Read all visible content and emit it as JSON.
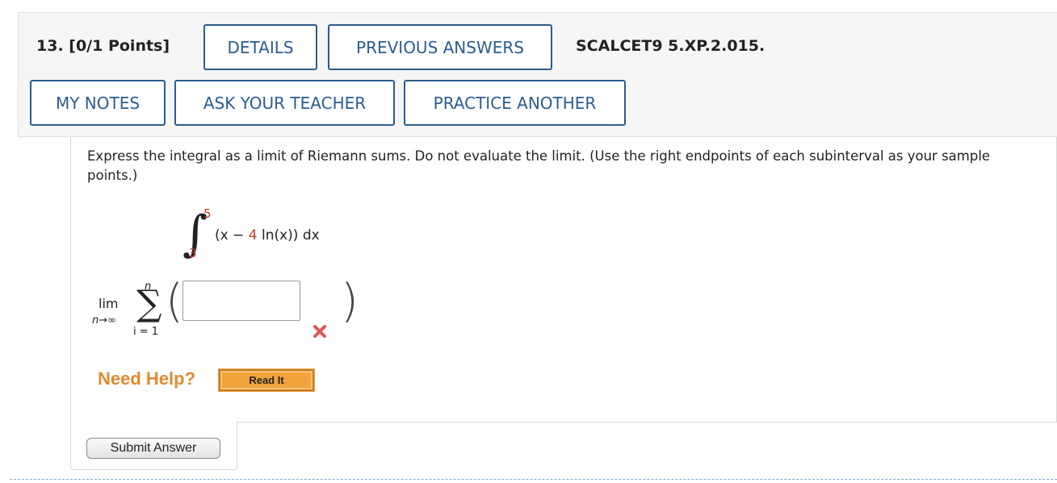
{
  "header": {
    "question_label": "13.  [0/1 Points]",
    "details_label": "DETAILS",
    "previous_answers_label": "PREVIOUS ANSWERS",
    "question_code": "SCALCET9 5.XP.2.015.",
    "my_notes_label": "MY NOTES",
    "ask_teacher_label": "ASK YOUR TEACHER",
    "practice_another_label": "PRACTICE ANOTHER"
  },
  "question": {
    "instructions": "Express the integral as a limit of Riemann sums. Do not evaluate the limit. (Use the right endpoints of each subinterval as your sample points.)",
    "integral": {
      "upper_limit": "5",
      "lower_limit": "3",
      "integrand_open": "(x − ",
      "coefficient": "4",
      "integrand_rest": " ln(x)) dx"
    },
    "limit_label": "lim",
    "limit_subscript": "n→∞",
    "sum_upper": "n",
    "sum_lower": "i = 1",
    "answer_value": "",
    "answer_status": "incorrect",
    "status_color": "#e05555"
  },
  "help": {
    "need_help_label": "Need Help?",
    "read_it_label": "Read It"
  },
  "submit": {
    "label": "Submit Answer"
  },
  "colors": {
    "accent": "#2a5d8f",
    "help_orange": "#e08a2e",
    "limit_red": "#c0392b"
  }
}
